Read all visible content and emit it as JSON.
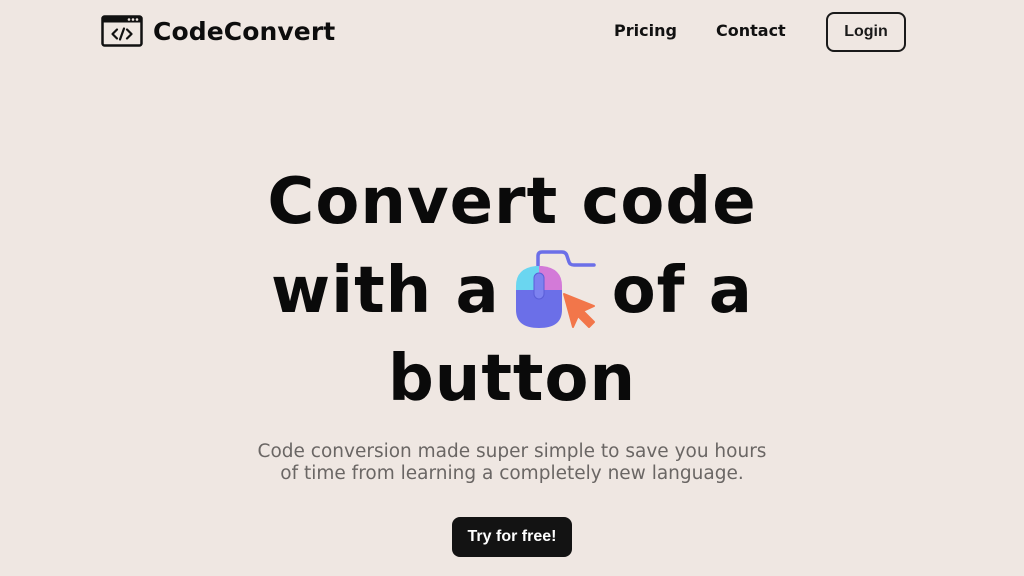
{
  "header": {
    "brand_name": "CodeConvert",
    "brand_icon": "code-window-icon",
    "nav": {
      "pricing_label": "Pricing",
      "contact_label": "Contact"
    },
    "login_label": "Login"
  },
  "hero": {
    "title_line1": "Convert code",
    "title_line2_before": "with a",
    "title_line2_after": "of a",
    "title_line3": "button",
    "title_icon": "computer-mouse-click-icon",
    "subtitle_line1": "Code conversion made super simple to save you hours",
    "subtitle_line2": "of time from learning a completely new language.",
    "cta_label": "Try for free!"
  },
  "colors": {
    "background": "#efe7e2",
    "text": "#0d0d0d",
    "subtitle": "#6a6664",
    "cta_background": "#131313",
    "cta_text": "#ffffff",
    "mouse_body": "#6b6fe8",
    "mouse_left_button": "#6ad6f0",
    "mouse_right_button": "#d37ad8",
    "cursor": "#f2764a"
  }
}
